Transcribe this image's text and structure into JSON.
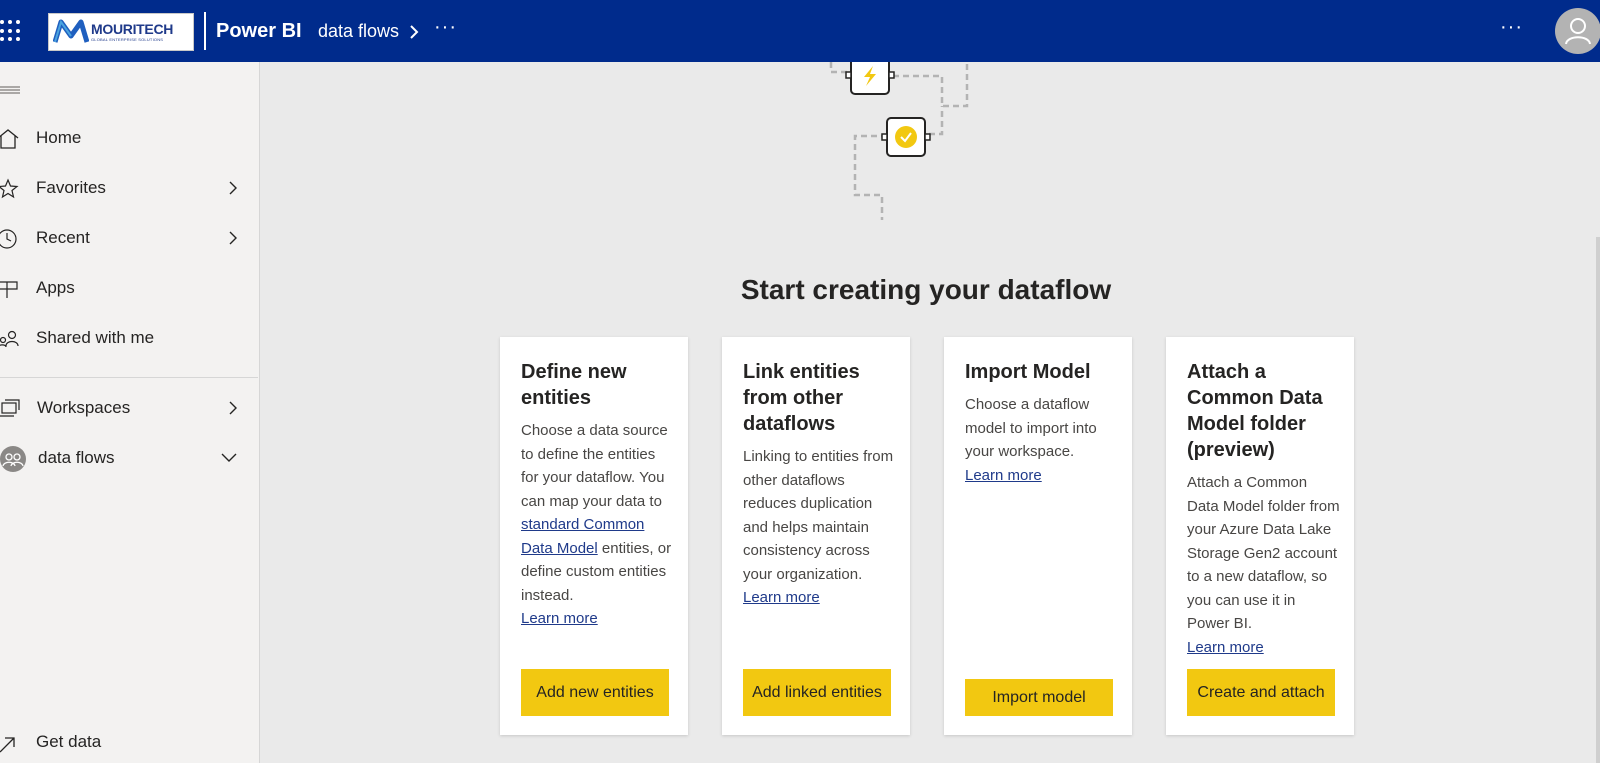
{
  "topbar": {
    "brand_name": "MOURITECH",
    "brand_tagline": "GLOBAL ENTERPRISE SOLUTIONS",
    "product": "Power BI",
    "breadcrumb": "data flows",
    "more": "···"
  },
  "sidebar": {
    "items": [
      {
        "label": "Home",
        "icon": "home-icon"
      },
      {
        "label": "Favorites",
        "icon": "star-icon"
      },
      {
        "label": "Recent",
        "icon": "clock-icon"
      },
      {
        "label": "Apps",
        "icon": "apps-icon"
      },
      {
        "label": "Shared with me",
        "icon": "shared-icon"
      },
      {
        "label": "Workspaces",
        "icon": "workspaces-icon"
      },
      {
        "label": "data flows",
        "icon": "workspace-avatar-icon"
      },
      {
        "label": "Get data",
        "icon": "get-data-arrow-icon"
      }
    ]
  },
  "main": {
    "title": "Start creating your dataflow",
    "cards": [
      {
        "title": "Define new entities",
        "desc_before": "Choose a data source to define the entities for your dataflow. You can map your data to ",
        "desc_link": "standard Common Data Model",
        "desc_after": " entities, or define custom entities instead.",
        "learn": "Learn more",
        "button": "Add new entities"
      },
      {
        "title": "Link entities from other dataflows",
        "desc": "Linking to entities from other dataflows reduces duplication and helps maintain consistency across your organization.",
        "learn": "Learn more",
        "button": "Add linked entities"
      },
      {
        "title": "Import Model",
        "desc": "Choose a dataflow model to import into your workspace.",
        "learn": "Learn more",
        "button": "Import model"
      },
      {
        "title": "Attach a Common Data Model folder (preview)",
        "desc": "Attach a Common Data Model folder from your Azure Data Lake Storage Gen2 account to a new dataflow, so you can use it in Power BI.",
        "learn": "Learn more",
        "button": "Create and attach"
      }
    ]
  },
  "colors": {
    "header": "#002b8c",
    "accent": "#f2c811",
    "link": "#1f3a8a"
  }
}
